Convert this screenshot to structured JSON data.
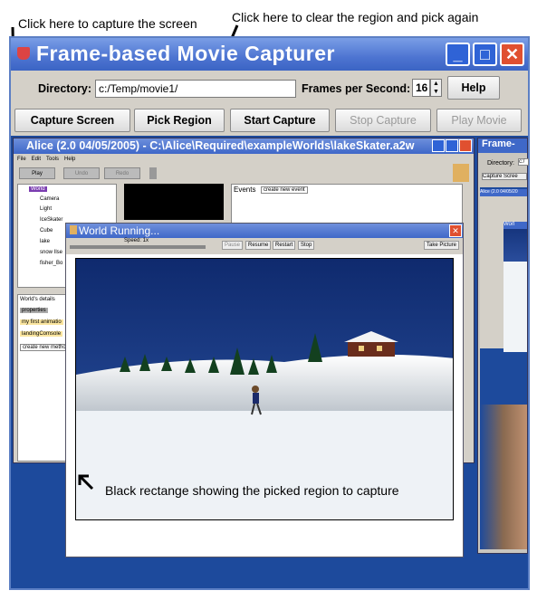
{
  "annotations": {
    "capture_note": "Click here to capture the screen",
    "clear_note": "Click here to clear the region and pick again",
    "rect_note": "Black rectange showing the picked region to capture"
  },
  "window": {
    "title": "Frame-based Movie Capturer",
    "min": "_",
    "max": "□",
    "close": "✕"
  },
  "toolbar": {
    "directory_label": "Directory:",
    "directory_value": "c:/Temp/movie1/",
    "fps_label": "Frames per Second:",
    "fps_value": "16",
    "help": "Help",
    "capture": "Capture Screen",
    "pick": "Pick Region",
    "start": "Start Capture",
    "stop": "Stop Capture",
    "play": "Play Movie"
  },
  "alice": {
    "title": "Alice (2.0 04/05/2005) - C:\\Alice\\Required\\exampleWorlds\\lakeSkater.a2w",
    "menu": [
      "File",
      "Edit",
      "Tools",
      "Help"
    ],
    "play": "Play",
    "undo": "Undo",
    "redo": "Redo",
    "tree": [
      "World",
      "Camera",
      "Light",
      "IceSkater",
      "Cube",
      "lake",
      "snow Ilse",
      "fisher_Bo"
    ],
    "events": "Events",
    "create_event": "create new event",
    "world_details": "World's details",
    "tabs": [
      "properties",
      "methods"
    ],
    "methods": [
      "my first animatio",
      "landingComsole",
      "create new metho"
    ]
  },
  "world_running": {
    "title": "World Running...",
    "speed": "Speed: 1x",
    "pause": "Pause",
    "resume": "Resume",
    "restart": "Restart",
    "stop": "Stop",
    "take_picture": "Take Picture"
  },
  "side_window": {
    "title": "Frame-",
    "directory": "Directory:",
    "dir_val": "c:/",
    "capture": "Capture Scree",
    "alice_title": "Alice (2.0 04/05/20",
    "world_title": "Worl"
  },
  "colors": {
    "accent": "#3b64c4",
    "sky": "#1e3f8c",
    "snow": "#f0f4f8"
  }
}
